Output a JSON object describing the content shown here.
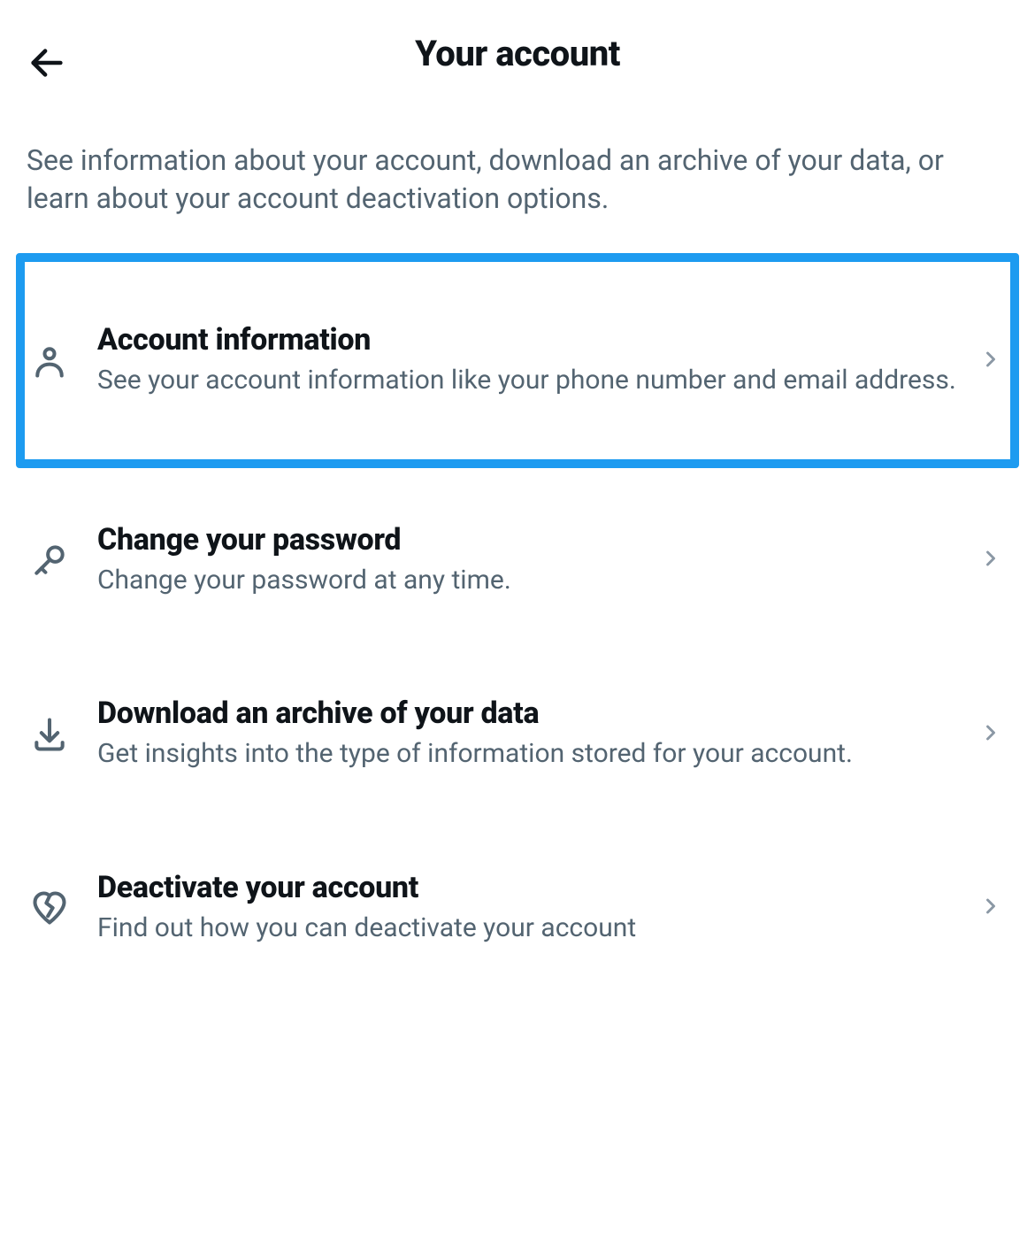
{
  "header": {
    "title": "Your account"
  },
  "description": "See information about your account, download an archive of your data, or learn about your account deactivation options.",
  "items": [
    {
      "title": "Account information",
      "subtitle": "See your account information like your phone number and email address."
    },
    {
      "title": "Change your password",
      "subtitle": "Change your password at any time."
    },
    {
      "title": "Download an archive of your data",
      "subtitle": "Get insights into the type of information stored for your account."
    },
    {
      "title": "Deactivate your account",
      "subtitle": "Find out how you can deactivate your account"
    }
  ]
}
